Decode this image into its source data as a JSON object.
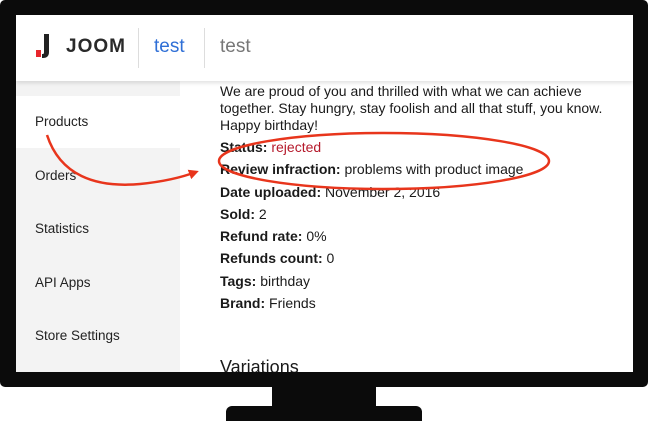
{
  "header": {
    "logo_text": "JOOM",
    "breadcrumb_link": "test",
    "breadcrumb_current": "test"
  },
  "sidebar": {
    "items": [
      {
        "label": "Products",
        "active": true
      },
      {
        "label": "Orders",
        "active": false
      },
      {
        "label": "Statistics",
        "active": false
      },
      {
        "label": "API Apps",
        "active": false
      },
      {
        "label": "Store Settings",
        "active": false
      }
    ]
  },
  "product": {
    "description": "We are proud of you and thrilled with what we can achieve together. Stay hungry, stay foolish and all that stuff, you know. Happy birthday!",
    "status_label": "Status:",
    "status_value": "rejected",
    "review_label": "Review infraction:",
    "review_value": "problems with product image",
    "date_label": "Date uploaded:",
    "date_value": "November 2, 2016",
    "sold_label": "Sold:",
    "sold_value": "2",
    "refund_rate_label": "Refund rate:",
    "refund_rate_value": "0%",
    "refunds_count_label": "Refunds count:",
    "refunds_count_value": "0",
    "tags_label": "Tags:",
    "tags_value": "birthday",
    "brand_label": "Brand:",
    "brand_value": "Friends"
  },
  "variations_heading": "Variations",
  "colors": {
    "brand_red": "#e8262c",
    "link_blue": "#2f6fd6",
    "status_rejected": "#b5192b",
    "annotation_red": "#e8351c"
  }
}
